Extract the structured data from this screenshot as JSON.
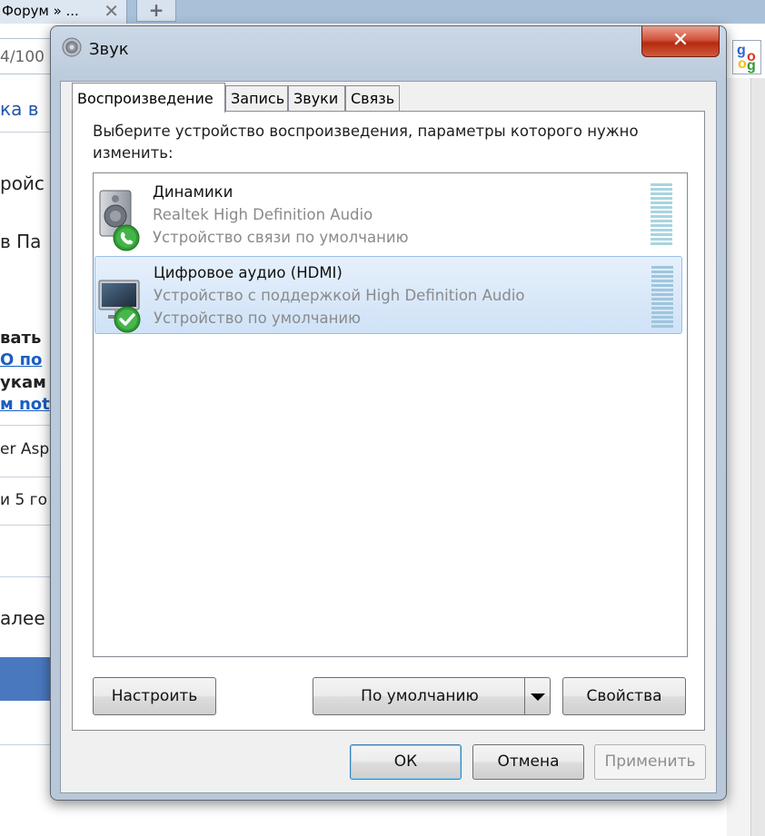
{
  "browser": {
    "tab_title": "Форум » ...",
    "tab_close": "✕",
    "new_tab": "+",
    "address_fragment": "4/100",
    "bg_lines": [
      "ка в",
      "ройс",
      "в Па",
      "вать",
      "О по",
      "укам",
      "м not",
      "er Asp",
      "и 5 го",
      "алее"
    ]
  },
  "dialog": {
    "title": "Звук",
    "close_label": "✕",
    "tabs": [
      {
        "label": "Воспроизведение",
        "active": true
      },
      {
        "label": "Запись",
        "active": false
      },
      {
        "label": "Звуки",
        "active": false
      },
      {
        "label": "Связь",
        "active": false
      }
    ],
    "description": "Выберите устройство воспроизведения, параметры которого нужно изменить:",
    "devices": [
      {
        "name": "Динамики",
        "driver": "Realtek High Definition Audio",
        "status": "Устройство связи по умолчанию",
        "icon": "speaker-icon",
        "badge": "phone-badge-icon",
        "selected": false
      },
      {
        "name": "Цифровое аудио (HDMI)",
        "driver": "Устройство с поддержкой High Definition Audio",
        "status": "Устройство по умолчанию",
        "icon": "monitor-icon",
        "badge": "check-badge-icon",
        "selected": true
      }
    ],
    "buttons": {
      "configure": "Настроить",
      "set_default": "По умолчанию",
      "properties": "Свойства",
      "ok": "ОК",
      "cancel": "Отмена",
      "apply": "Применить"
    }
  },
  "colors": {
    "selection": "#cfe2f7",
    "close_button": "#c94b2f",
    "status_badge": "#2f9a34"
  }
}
